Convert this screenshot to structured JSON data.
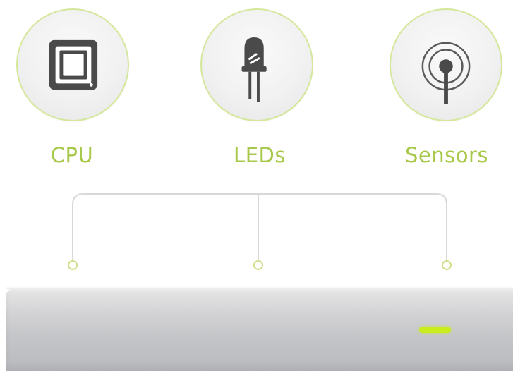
{
  "components": [
    {
      "id": "cpu",
      "label": "CPU",
      "icon": "cpu-chip-icon"
    },
    {
      "id": "leds",
      "label": "LEDs",
      "icon": "led-bulb-icon"
    },
    {
      "id": "sensors",
      "label": "Sensors",
      "icon": "sensor-antenna-icon"
    }
  ],
  "colors": {
    "accent": "#a8c84a",
    "circle_border": "#d4e79a",
    "icon": "#4a4a4a",
    "connector_line": "#d8d8d8",
    "led_indicator": "#c8ec1c"
  }
}
